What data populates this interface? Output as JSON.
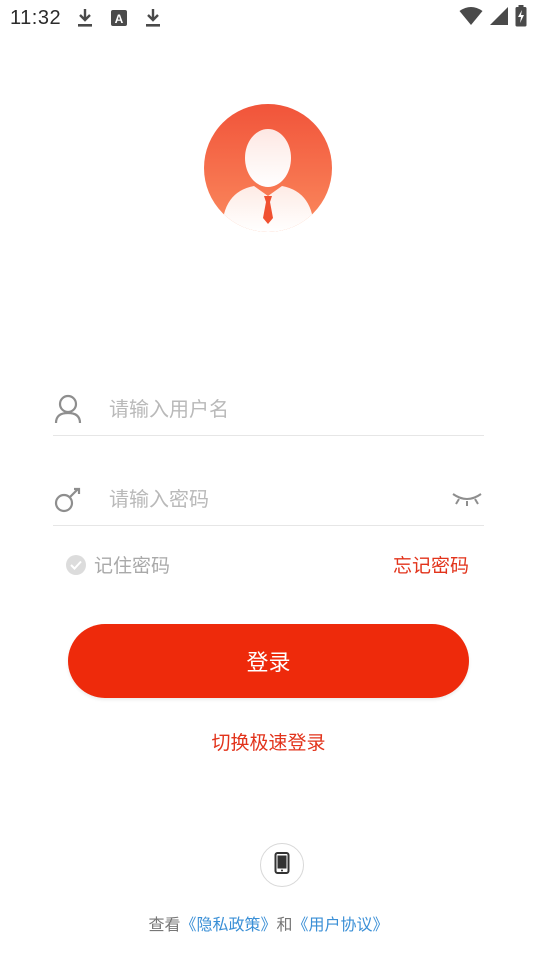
{
  "status_bar": {
    "time": "11:32",
    "left_icons": [
      "download-icon",
      "font-a-icon",
      "download-icon"
    ],
    "right_icons": [
      "wifi-icon",
      "signal-icon",
      "battery-charging-icon"
    ]
  },
  "avatar": {
    "icon": "user-avatar-icon",
    "colors": {
      "top": "#f1543a",
      "bottom": "#fb8a5e"
    }
  },
  "login_form": {
    "username": {
      "placeholder": "请输入用户名",
      "value": "",
      "icon": "user-icon"
    },
    "password": {
      "placeholder": "请输入密码",
      "value": "",
      "icon": "key-icon",
      "toggle_icon": "eye-closed-icon"
    },
    "remember_label": "记住密码",
    "forgot_label": "忘记密码",
    "submit_label": "登录",
    "switch_label": "切换极速登录"
  },
  "footer": {
    "phone_icon": "phone-icon",
    "agreement_prefix": "查看",
    "privacy_link": "《隐私政策》",
    "and_text": "和",
    "terms_link": "《用户协议》"
  },
  "colors": {
    "accent": "#ee2a0b",
    "link": "#3a8fd6",
    "placeholder": "#b9b9b9"
  }
}
